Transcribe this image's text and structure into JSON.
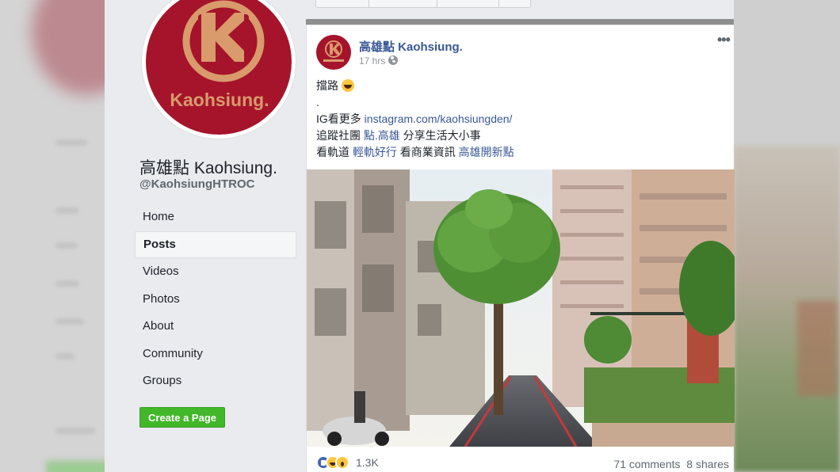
{
  "page": {
    "name": "高雄點 Kaohsiung.",
    "handle": "@KaohsiungHTROC",
    "logo_text": "Kaohsiung.",
    "brand_color": "#a5142b",
    "logo_color": "#d99a6c"
  },
  "nav": {
    "items": [
      {
        "label": "Home"
      },
      {
        "label": "Posts",
        "active": true
      },
      {
        "label": "Videos"
      },
      {
        "label": "Photos"
      },
      {
        "label": "About"
      },
      {
        "label": "Community"
      },
      {
        "label": "Groups"
      }
    ],
    "create_page_label": "Create a Page"
  },
  "post": {
    "author": "高雄點 Kaohsiung.",
    "time": "17 hrs",
    "privacy_icon": "globe-icon",
    "lines": {
      "l1": "擋路",
      "l2": ".",
      "l3_prefix": "IG看更多 ",
      "l3_link": "instagram.com/kaohsiungden/",
      "l4_prefix": "追蹤社團 ",
      "l4_link": "點.高雄",
      "l4_suffix": " 分享生活大小事",
      "l5_prefix": "看軌道 ",
      "l5_link1": "輕軌好行",
      "l5_mid": " 看商業資訊 ",
      "l5_link2": "高雄開新點"
    },
    "reactions": {
      "icons": [
        "like-icon",
        "haha-icon",
        "wow-icon"
      ],
      "count": "1.3K"
    },
    "comments": "71 comments",
    "shares": "8 shares"
  }
}
